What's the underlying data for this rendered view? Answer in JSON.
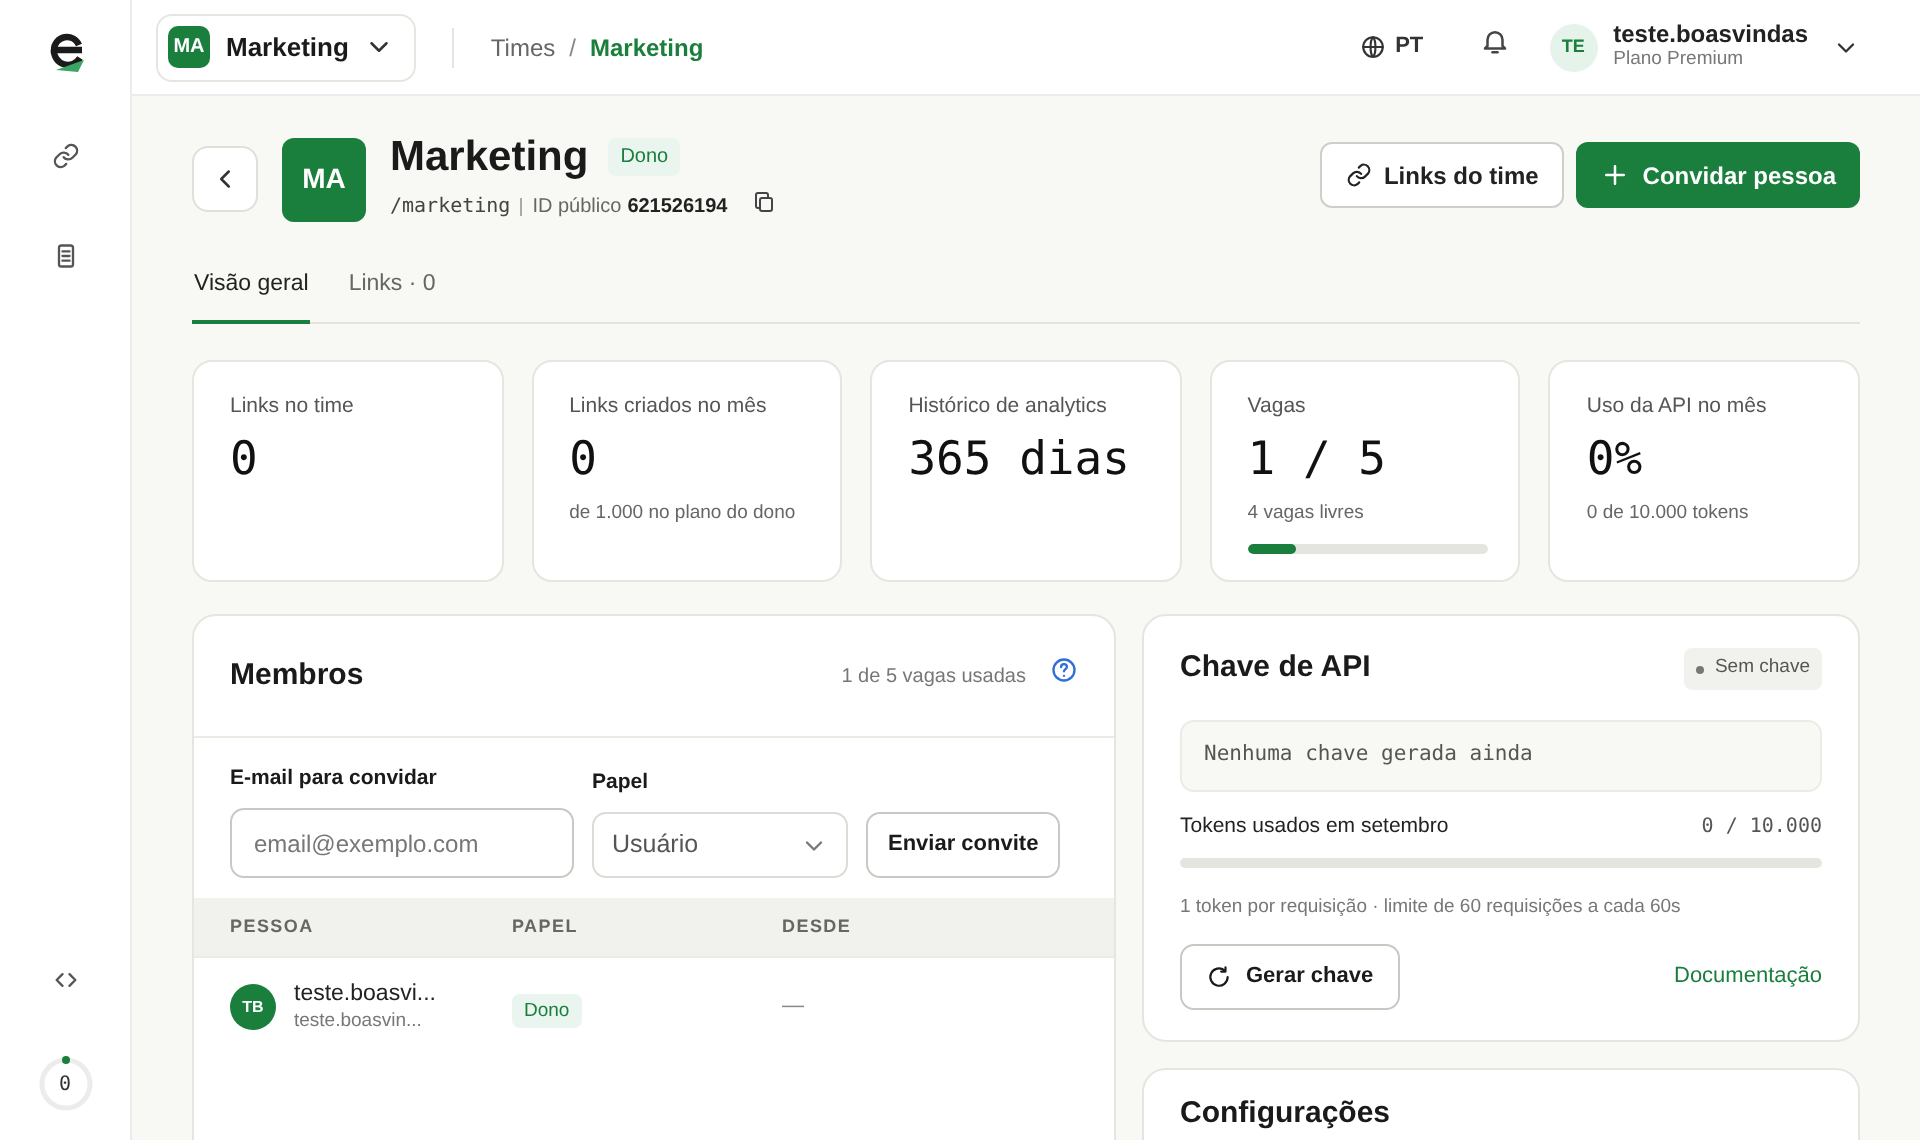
{
  "sidebar": {
    "usage_ring": {
      "label": "0",
      "level": 0
    }
  },
  "header": {
    "team_switcher": {
      "initials": "MA",
      "name": "Marketing"
    },
    "breadcrumb": {
      "items": [
        "Times",
        "Marketing"
      ],
      "separator": "/"
    },
    "language": "PT",
    "user": {
      "initials": "TE",
      "name": "teste.boasvindas",
      "plan": "Plano Premium"
    }
  },
  "team": {
    "initials": "MA",
    "name": "Marketing",
    "badge": "Dono",
    "slug": "/marketing",
    "id_label": "ID público",
    "id": "621526194",
    "buttons": [
      {
        "label": "Links do time",
        "kind": "secondary"
      },
      {
        "label": "Convidar pessoa",
        "kind": "primary"
      }
    ]
  },
  "tabs": [
    {
      "label": "Visão geral",
      "selected": true
    },
    {
      "label": "Links · 0",
      "selected": false
    }
  ],
  "stats": [
    {
      "label": "Links no time",
      "value": "0"
    },
    {
      "label": "Links criados no mês",
      "value": "0",
      "note": "de 1.000 no plano do dono"
    },
    {
      "label": "Histórico de analytics",
      "value": "365 dias"
    },
    {
      "label": "Vagas",
      "value": "1 / 5",
      "note": "4 vagas livres",
      "level": 0.2
    },
    {
      "label": "Uso da API no mês",
      "value": "0%",
      "note": "0 de 10.000 tokens"
    }
  ],
  "members": {
    "title": "Membros",
    "usage": "1 de 5 vagas usadas",
    "email_label": "E-mail para convidar",
    "email_placeholder": "email@exemplo.com",
    "role_label": "Papel",
    "role_value": "Usuário",
    "send_button": "Enviar convite",
    "columns": [
      "PESSOA",
      "PAPEL",
      "DESDE"
    ],
    "rows": [
      {
        "initials": "TB",
        "name": "teste.boasvi...",
        "email": "teste.boasvin...",
        "role": "Dono",
        "since": "—"
      }
    ]
  },
  "api_key": {
    "title": "Chave de API",
    "status": "Sem chave",
    "key_text": "Nenhuma chave gerada ainda",
    "tokens_label": "Tokens usados em setembro",
    "tokens_value": "0 / 10.000",
    "level": 0,
    "note": "1 token por requisição · limite de 60 requisições a cada 60s",
    "button": "Gerar chave",
    "link": "Documentação"
  },
  "settings": {
    "title": "Configurações"
  }
}
